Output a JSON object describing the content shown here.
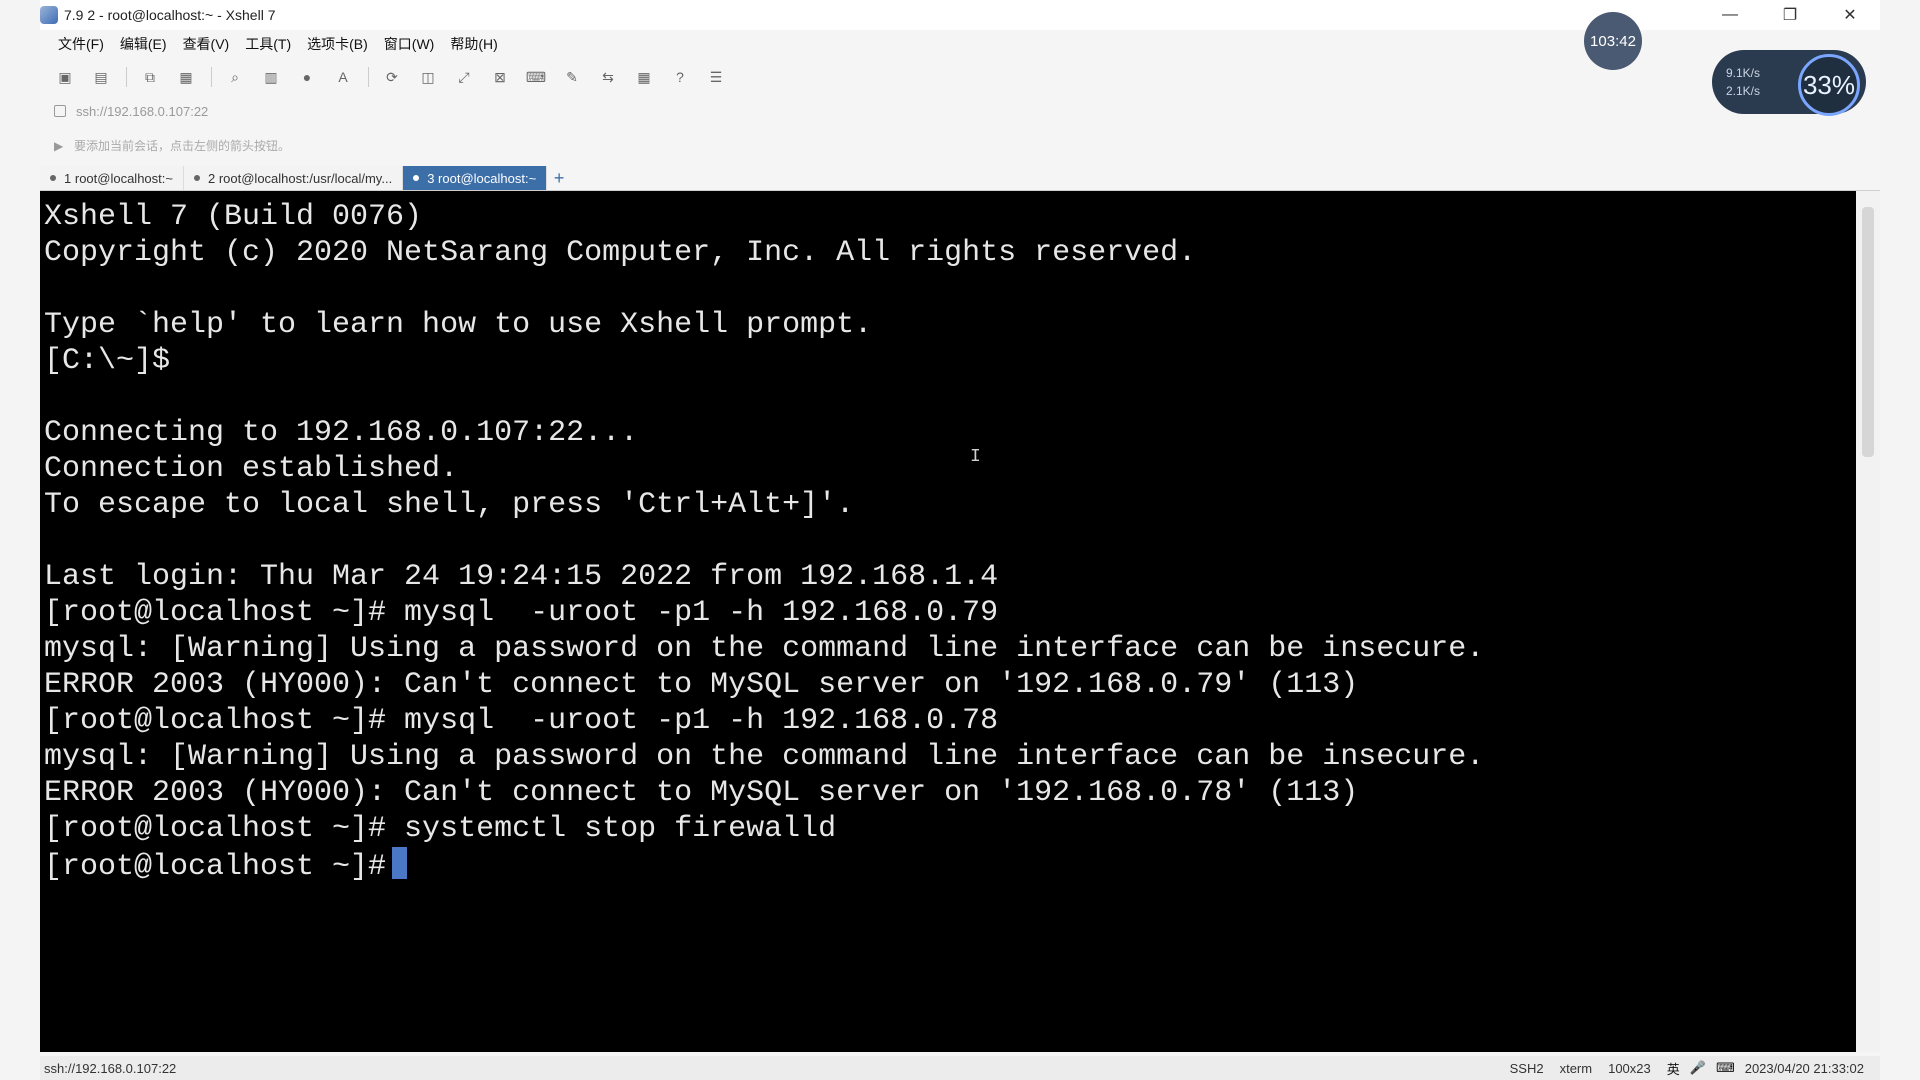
{
  "window": {
    "title": "7.9 2 - root@localhost:~ - Xshell 7"
  },
  "menu": [
    "文件(F)",
    "编辑(E)",
    "查看(V)",
    "工具(T)",
    "选项卡(B)",
    "窗口(W)",
    "帮助(H)"
  ],
  "toolbar": {
    "icons": [
      "new-session-icon",
      "open-icon",
      "copy-icon",
      "paste-icon",
      "find-icon",
      "print-icon",
      "globe-icon",
      "font-icon",
      "refresh-icon",
      "screenshot-icon",
      "fullscreen-icon",
      "lock-icon",
      "keyboard-icon",
      "script-icon",
      "transfer-icon",
      "layout-icon",
      "help-icon",
      "chat-icon"
    ]
  },
  "address": {
    "text": "ssh://192.168.0.107:22"
  },
  "hint": {
    "text": "要添加当前会话，点击左侧的箭头按钮。"
  },
  "tabs": [
    {
      "number": "1",
      "label": "root@localhost:~"
    },
    {
      "number": "2",
      "label": "root@localhost:/usr/local/my..."
    },
    {
      "number": "3",
      "label": "root@localhost:~"
    }
  ],
  "terminal": {
    "lines": [
      "Xshell 7 (Build 0076)",
      "Copyright (c) 2020 NetSarang Computer, Inc. All rights reserved.",
      "",
      "Type `help' to learn how to use Xshell prompt.",
      "[C:\\~]$",
      "",
      "Connecting to 192.168.0.107:22...",
      "Connection established.",
      "To escape to local shell, press 'Ctrl+Alt+]'.",
      "",
      "Last login: Thu Mar 24 19:24:15 2022 from 192.168.1.4",
      "[root@localhost ~]# mysql  -uroot -p1 -h 192.168.0.79",
      "mysql: [Warning] Using a password on the command line interface can be insecure.",
      "ERROR 2003 (HY000): Can't connect to MySQL server on '192.168.0.79' (113)",
      "[root@localhost ~]# mysql  -uroot -p1 -h 192.168.0.78",
      "mysql: [Warning] Using a password on the command line interface can be insecure.",
      "ERROR 2003 (HY000): Can't connect to MySQL server on '192.168.0.78' (113)",
      "[root@localhost ~]# systemctl stop firewalld",
      "[root@localhost ~]#"
    ]
  },
  "status": {
    "left": "ssh://192.168.0.107:22",
    "protocol": "SSH2",
    "term": "xterm",
    "size": "100x23",
    "ime_label": "英",
    "datetime": "2023/04/20 21:33:02"
  },
  "overlay": {
    "timer": "103:42",
    "speed_up": "9.1K/s",
    "speed_down": "2.1K/s",
    "percent": "33%"
  },
  "colors": {
    "accent": "#3c6ea8",
    "terminal_bg": "#000000",
    "terminal_fg": "#e7e7e7",
    "cursor": "#4a78c6"
  }
}
